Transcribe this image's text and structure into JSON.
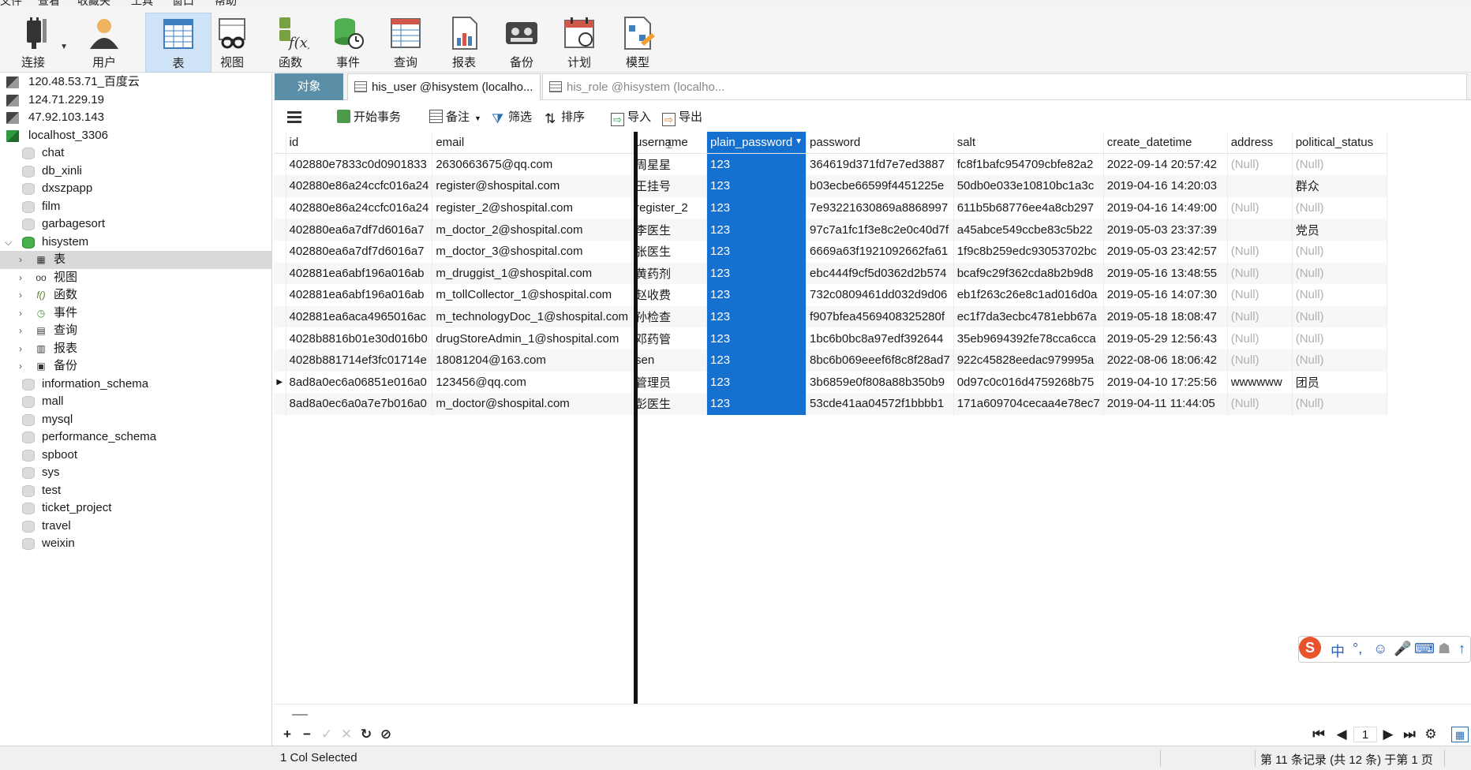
{
  "menubar": [
    "文件",
    "查看",
    "收藏夹",
    "工具",
    "窗口",
    "帮助"
  ],
  "toolbar": {
    "connect": "连接",
    "user": "用户",
    "table": "表",
    "view": "视图",
    "function": "函数",
    "event": "事件",
    "query": "查询",
    "report": "报表",
    "backup": "备份",
    "schedule": "计划",
    "model": "模型"
  },
  "tree": {
    "connections": [
      "120.48.53.71_百度云",
      "124.71.229.19",
      "47.92.103.143",
      "localhost_3306"
    ],
    "databases_before": [
      "chat",
      "db_xinli",
      "dxszpapp",
      "film",
      "garbagesort"
    ],
    "active_db": "hisystem",
    "active_children": [
      "表",
      "视图",
      "函数",
      "事件",
      "查询",
      "报表",
      "备份"
    ],
    "databases_after": [
      "information_schema",
      "mall",
      "mysql",
      "performance_schema",
      "spboot",
      "sys",
      "test",
      "ticket_project",
      "travel",
      "weixin"
    ]
  },
  "tabs": {
    "objects": "对象",
    "tab1": "his_user @hisystem (localho...",
    "tab2": "his_role @hisystem (localho..."
  },
  "gridbar": {
    "begin_tx": "开始事务",
    "note": "备注",
    "filter": "筛选",
    "sort": "排序",
    "import": "导入",
    "export": "导出"
  },
  "grid": {
    "columns": [
      "id",
      "email",
      "username",
      "plain_password",
      "password",
      "salt",
      "create_datetime",
      "address",
      "political_status"
    ],
    "rows": [
      [
        "402880e7833c0d0901833",
        "2630663675@qq.com",
        "周星星",
        "123",
        "364619d371fd7e7ed3887",
        "fc8f1bafc954709cbfe82a2",
        "2022-09-14 20:57:42",
        "(Null)",
        "(Null)"
      ],
      [
        "402880e86a24ccfc016a24",
        "register@shospital.com",
        "王挂号",
        "123",
        "b03ecbe66599f4451225e",
        "50db0e033e10810bc1a3c",
        "2019-04-16 14:20:03",
        "",
        "群众"
      ],
      [
        "402880e86a24ccfc016a24",
        "register_2@shospital.com",
        "register_2",
        "123",
        "7e93221630869a8868997",
        "611b5b68776ee4a8cb297",
        "2019-04-16 14:49:00",
        "(Null)",
        "(Null)"
      ],
      [
        "402880ea6a7df7d6016a7",
        "m_doctor_2@shospital.com",
        "李医生",
        "123",
        "97c7a1fc1f3e8c2e0c40d7f",
        "a45abce549ccbe83c5b22",
        "2019-05-03 23:37:39",
        "",
        "党员"
      ],
      [
        "402880ea6a7df7d6016a7",
        "m_doctor_3@shospital.com",
        "张医生",
        "123",
        "6669a63f1921092662fa61",
        "1f9c8b259edc93053702bc",
        "2019-05-03 23:42:57",
        "(Null)",
        "(Null)"
      ],
      [
        "402881ea6abf196a016ab",
        "m_druggist_1@shospital.com",
        "黄药剂",
        "123",
        "ebc444f9cf5d0362d2b574",
        "bcaf9c29f362cda8b2b9d8",
        "2019-05-16 13:48:55",
        "(Null)",
        "(Null)"
      ],
      [
        "402881ea6abf196a016ab",
        "m_tollCollector_1@shospital.com",
        "赵收费",
        "123",
        "732c0809461dd032d9d06",
        "eb1f263c26e8c1ad016d0a",
        "2019-05-16 14:07:30",
        "(Null)",
        "(Null)"
      ],
      [
        "402881ea6aca4965016ac",
        "m_technologyDoc_1@shospital.com",
        "孙检查",
        "123",
        "f907bfea4569408325280f",
        "ec1f7da3ecbc4781ebb67a",
        "2019-05-18 18:08:47",
        "(Null)",
        "(Null)"
      ],
      [
        "4028b8816b01e30d016b0",
        "drugStoreAdmin_1@shospital.com",
        "邓药管",
        "123",
        "1bc6b0bc8a97edf392644",
        "35eb9694392fe78cca6cca",
        "2019-05-29 12:56:43",
        "(Null)",
        "(Null)"
      ],
      [
        "4028b881714ef3fc01714e",
        "18081204@163.com",
        "sen",
        "123",
        "8bc6b069eeef6f8c8f28ad7",
        "922c45828eedac979995a",
        "2022-08-06 18:06:42",
        "(Null)",
        "(Null)"
      ],
      [
        "8ad8a0ec6a06851e016a0",
        "123456@qq.com",
        "管理员",
        "123",
        "3b6859e0f808a88b350b9",
        "0d97c0c016d4759268b75",
        "2019-04-10 17:25:56",
        "wwwwww",
        "团员"
      ],
      [
        "8ad8a0ec6a0a7e7b016a0",
        "m_doctor@shospital.com",
        "彭医生",
        "123",
        "53cde41aa04572f1bbbb1",
        "171a609704cecaa4e78ec7",
        "2019-04-11 11:44:05",
        "(Null)",
        "(Null)"
      ]
    ]
  },
  "pager": {
    "page": "1"
  },
  "status": {
    "left": "1 Col Selected",
    "right": "第 11 条记录 (共 12 条) 于第 1 页"
  },
  "ime": {
    "logo": "S",
    "lang": "中"
  },
  "colors": {
    "selection": "#1670d0",
    "objects_tab": "#5b8fa8",
    "active_tool": "#cfe3f6"
  }
}
